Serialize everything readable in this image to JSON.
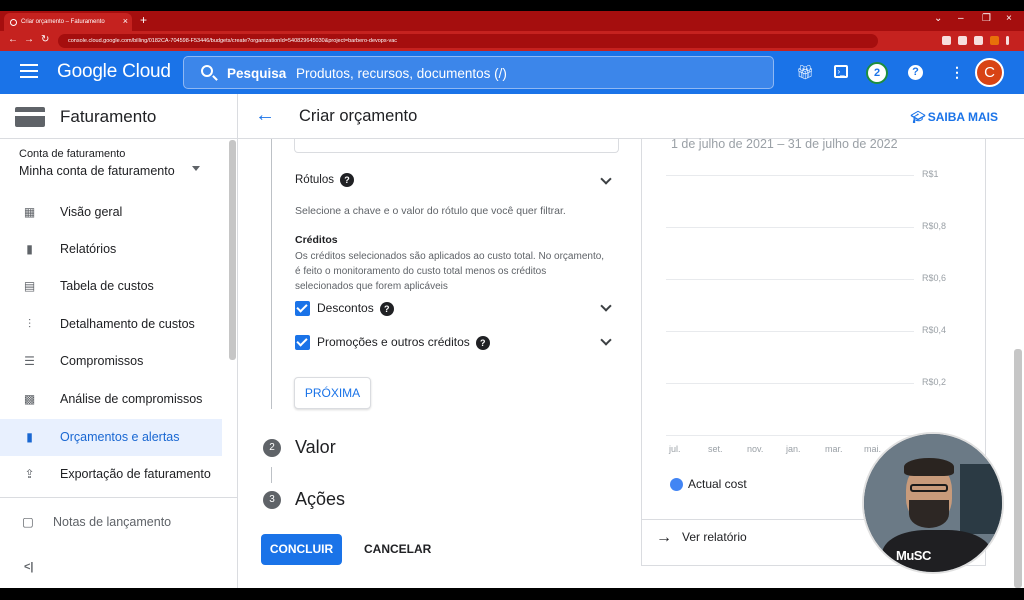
{
  "browser": {
    "tab_title": "Criar orçamento – Faturamento",
    "url": "console.cloud.google.com/billing/0182CA-704598-F53446/budgets/create?organizationId=540829645030&project=barbero-devops-vac"
  },
  "header": {
    "logo": "Google Cloud",
    "search_label": "Pesquisa",
    "search_placeholder": "Produtos, recursos, documentos (/)",
    "notifications_count": "2",
    "avatar_letter": "C"
  },
  "sidebar": {
    "title": "Faturamento",
    "account_label": "Conta de faturamento",
    "account_value": "Minha conta de faturamento",
    "items": [
      {
        "label": "Visão geral",
        "icon": "dashboard-icon"
      },
      {
        "label": "Relatórios",
        "icon": "bar-chart-icon"
      },
      {
        "label": "Tabela de custos",
        "icon": "table-icon"
      },
      {
        "label": "Detalhamento de custos",
        "icon": "breakdown-icon"
      },
      {
        "label": "Compromissos",
        "icon": "list-icon"
      },
      {
        "label": "Análise de compromissos",
        "icon": "analysis-icon"
      },
      {
        "label": "Orçamentos e alertas",
        "icon": "budget-icon",
        "active": true
      },
      {
        "label": "Exportação de faturamento",
        "icon": "upload-icon"
      }
    ],
    "notes": "Notas de lançamento"
  },
  "page": {
    "title": "Criar orçamento",
    "learn_more": "SAIBA MAIS"
  },
  "form": {
    "labels_title": "Rótulos",
    "labels_desc": "Selecione a chave e o valor do rótulo que você quer filtrar.",
    "credits_title": "Créditos",
    "credits_desc": "Os créditos selecionados são aplicados ao custo total. No orçamento, é feito o monitoramento do custo total menos os créditos selecionados que forem aplicáveis",
    "checkboxes": [
      {
        "label": "Descontos",
        "checked": true
      },
      {
        "label": "Promoções e outros créditos",
        "checked": true
      }
    ],
    "next_button": "PRÓXIMA",
    "steps": [
      {
        "num": "2",
        "label": "Valor"
      },
      {
        "num": "3",
        "label": "Ações"
      }
    ],
    "submit_button": "CONCLUIR",
    "cancel_button": "CANCELAR"
  },
  "chart_data": {
    "type": "line",
    "title": "1 de julho de 2021 – 31 de julho de 2022",
    "categories": [
      "jul.",
      "set.",
      "nov.",
      "jan.",
      "mar.",
      "mai."
    ],
    "yticks": [
      "R$1",
      "R$0,8",
      "R$0,6",
      "R$0,4",
      "R$0,2"
    ],
    "ylim": [
      0,
      1
    ],
    "series": [
      {
        "name": "Actual cost",
        "color": "#4285f4",
        "values": []
      }
    ],
    "legend_position": "bottom-left"
  },
  "card": {
    "view_report": "Ver relatório"
  },
  "overlay": {
    "mic_text": "MuSC"
  }
}
